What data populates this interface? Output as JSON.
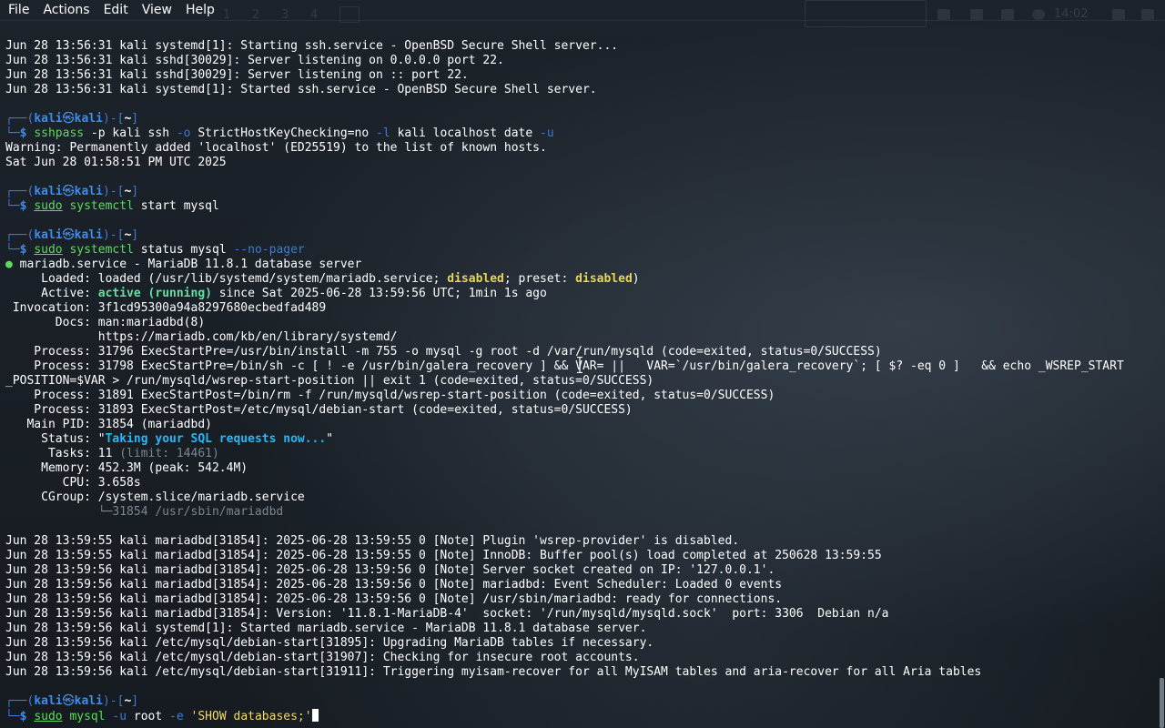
{
  "menubar": {
    "items": [
      "File",
      "Actions",
      "Edit",
      "View",
      "Help"
    ]
  },
  "panel": {
    "workspaces": [
      "1",
      "2",
      "3",
      "4"
    ],
    "clock": "14:02"
  },
  "prompt": {
    "user": "kali",
    "host": "kali",
    "dir": "~"
  },
  "terminal": {
    "pre_lines": [
      "Jun 28 13:56:31 kali systemd[1]: Starting ssh.service - OpenBSD Secure Shell server...",
      "Jun 28 13:56:31 kali sshd[30029]: Server listening on 0.0.0.0 port 22.",
      "Jun 28 13:56:31 kali sshd[30029]: Server listening on :: port 22.",
      "Jun 28 13:56:31 kali systemd[1]: Started ssh.service - OpenBSD Secure Shell server."
    ],
    "cmd1": {
      "prog": "sshpass",
      "args": " -p kali ssh ",
      "opt1": "-o",
      "mid": " StrictHostKeyChecking=no ",
      "opt2": "-l",
      "tail": " kali localhost date ",
      "opt3": "-u"
    },
    "cmd1_out": [
      "Warning: Permanently added 'localhost' (ED25519) to the list of known hosts.",
      "Sat Jun 28 01:58:51 PM UTC 2025"
    ],
    "cmd2": {
      "sudo": "sudo",
      "prog": "systemctl",
      "args": " start mysql"
    },
    "cmd3": {
      "sudo": "sudo",
      "prog": "systemctl",
      "args": " status mysql ",
      "opt": "--no-pager"
    },
    "status": {
      "header": "mariadb.service - MariaDB 11.8.1 database server",
      "loaded_label": "     Loaded: ",
      "loaded_a": "loaded (/usr/lib/systemd/system/mariadb.service; ",
      "loaded_disabled": "disabled",
      "loaded_b": "; preset: ",
      "loaded_preset": "disabled",
      "loaded_c": ")",
      "active_label": "     Active: ",
      "active_state": "active (running)",
      "active_rest": " since Sat 2025-06-28 13:59:56 UTC; 1min 1s ago",
      "invocation": " Invocation: 3f1cd95300a94a8297680ecbedfad489",
      "docs1": "       Docs: man:mariadbd(8)",
      "docs2": "             https://mariadb.com/kb/en/library/systemd/",
      "proc1": "    Process: 31796 ExecStartPre=/usr/bin/install -m 755 -o mysql -g root -d /var/run/mysqld (code=exited, status=0/SUCCESS)",
      "proc2a": "    Process: 31798 ExecStartPre=/bin/sh -c [ ! -e /usr/bin/galera_recovery ] && VAR= ||   VAR=`/usr/bin/galera_recovery`; [ $? -eq 0 ]   && echo _WSREP_START",
      "proc2b": "_POSITION=$VAR > /run/mysqld/wsrep-start-position || exit 1 (code=exited, status=0/SUCCESS)",
      "proc3": "    Process: 31891 ExecStartPost=/bin/rm -f /run/mysqld/wsrep-start-position (code=exited, status=0/SUCCESS)",
      "proc4": "    Process: 31893 ExecStartPost=/etc/mysql/debian-start (code=exited, status=0/SUCCESS)",
      "mainpid": "   Main PID: 31854 (mariadbd)",
      "status_label": "     Status: \"",
      "status_text": "Taking your SQL requests now...",
      "status_end": "\"",
      "tasks_label": "      Tasks: 11 ",
      "tasks_limit": "(limit: 14461)",
      "memory": "     Memory: 452.3M (peak: 542.4M)",
      "cpu": "        CPU: 3.658s",
      "cgroup": "     CGroup: /system.slice/mariadb.service",
      "cgroup_child": "             └─31854 /usr/sbin/mariadbd"
    },
    "log_lines": [
      "Jun 28 13:59:55 kali mariadbd[31854]: 2025-06-28 13:59:55 0 [Note] Plugin 'wsrep-provider' is disabled.",
      "Jun 28 13:59:55 kali mariadbd[31854]: 2025-06-28 13:59:55 0 [Note] InnoDB: Buffer pool(s) load completed at 250628 13:59:55",
      "Jun 28 13:59:56 kali mariadbd[31854]: 2025-06-28 13:59:56 0 [Note] Server socket created on IP: '127.0.0.1'.",
      "Jun 28 13:59:56 kali mariadbd[31854]: 2025-06-28 13:59:56 0 [Note] mariadbd: Event Scheduler: Loaded 0 events",
      "Jun 28 13:59:56 kali mariadbd[31854]: 2025-06-28 13:59:56 0 [Note] /usr/sbin/mariadbd: ready for connections.",
      "Jun 28 13:59:56 kali mariadbd[31854]: Version: '11.8.1-MariaDB-4'  socket: '/run/mysqld/mysqld.sock'  port: 3306  Debian n/a",
      "Jun 28 13:59:56 kali systemd[1]: Started mariadb.service - MariaDB 11.8.1 database server.",
      "Jun 28 13:59:56 kali /etc/mysql/debian-start[31895]: Upgrading MariaDB tables if necessary.",
      "Jun 28 13:59:56 kali /etc/mysql/debian-start[31907]: Checking for insecure root accounts.",
      "Jun 28 13:59:56 kali /etc/mysql/debian-start[31911]: Triggering myisam-recover for all MyISAM tables and aria-recover for all Aria tables"
    ],
    "cmd4": {
      "sudo": "sudo",
      "prog": "mysql",
      "args": " ",
      "opt": "-u",
      "mid": " root ",
      "opt2": "-e",
      "str": " 'SHOW databases;'"
    }
  },
  "colors": {
    "prompt": "#3a7bd5",
    "command": "#5cdb5c",
    "active": "#62e09f",
    "warning": "#e5d55a",
    "status": "#29b6f6"
  }
}
